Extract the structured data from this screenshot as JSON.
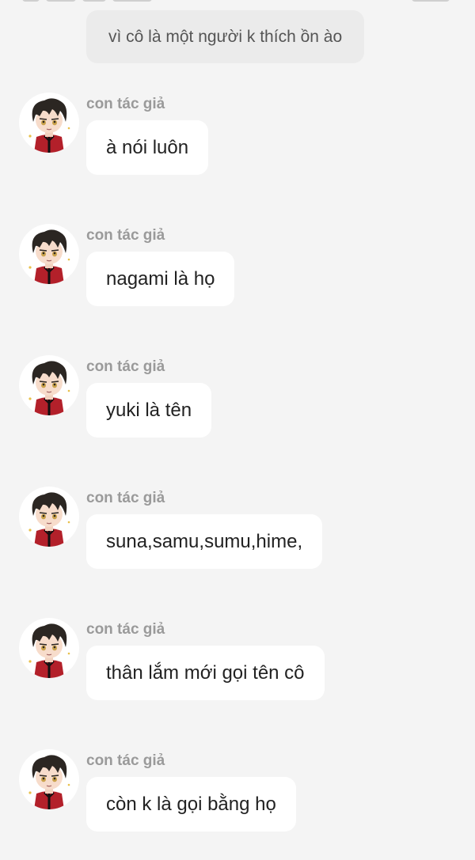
{
  "narration": {
    "text": "vì cô là một người k thích ồn ào"
  },
  "messages": [
    {
      "author": "con tác giả",
      "text": "à nói luôn",
      "avatar_icon": "chibi-boy-avatar"
    },
    {
      "author": "con tác giả",
      "text": "nagami là họ",
      "avatar_icon": "chibi-boy-avatar"
    },
    {
      "author": "con tác giả",
      "text": "yuki là tên",
      "avatar_icon": "chibi-boy-avatar"
    },
    {
      "author": "con tác giả",
      "text": "suna,samu,sumu,hime,",
      "avatar_icon": "chibi-boy-avatar"
    },
    {
      "author": "con tác giả",
      "text": "thân lắm mới gọi tên cô",
      "avatar_icon": "chibi-boy-avatar"
    },
    {
      "author": "con tác giả",
      "text": "còn k là gọi bằng họ",
      "avatar_icon": "chibi-boy-avatar"
    }
  ],
  "colors": {
    "background": "#f4f4f4",
    "bubble": "#ffffff",
    "narration_bubble": "#ebebeb",
    "author_text": "#9a9a9a",
    "message_text": "#222222",
    "avatar_jacket": "#b3202a",
    "avatar_hair": "#2b2622"
  }
}
